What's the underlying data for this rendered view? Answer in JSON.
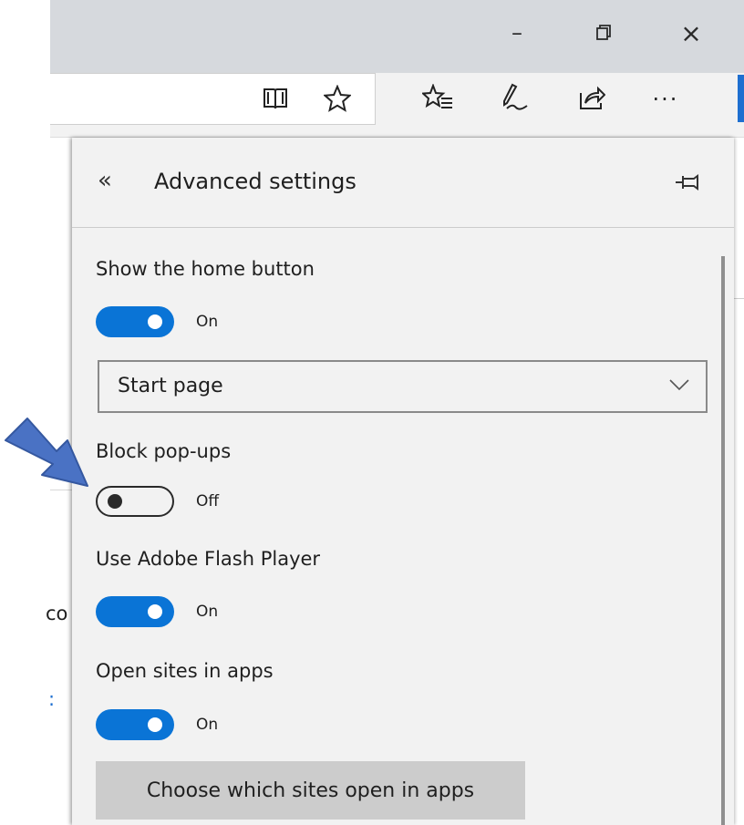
{
  "window": {
    "minimize_glyph": "–",
    "restore_glyph": "❐",
    "close_glyph": "×"
  },
  "toolbar": {
    "icons": [
      "reading-view-icon",
      "favorite-star-icon",
      "favorites-hub-icon",
      "web-note-icon",
      "share-icon",
      "more-icon"
    ],
    "more_label": "···"
  },
  "background_page": {
    "fragment_1": "co",
    "fragment_2": ":"
  },
  "panel": {
    "back_glyph": "«",
    "title": "Advanced settings",
    "settings": [
      {
        "label": "Show the home button",
        "state": "On",
        "enabled": true
      },
      {
        "label": "Block pop-ups",
        "state": "Off",
        "enabled": false
      },
      {
        "label": "Use Adobe Flash Player",
        "state": "On",
        "enabled": true
      },
      {
        "label": "Open sites in apps",
        "state": "On",
        "enabled": true
      }
    ],
    "home_select": {
      "value": "Start page"
    },
    "choose_button": "Choose which sites open in apps"
  },
  "colors": {
    "toggle_on": "#0a74d6",
    "arrow": "#4a72c4",
    "accent": "#1e6fd0"
  }
}
